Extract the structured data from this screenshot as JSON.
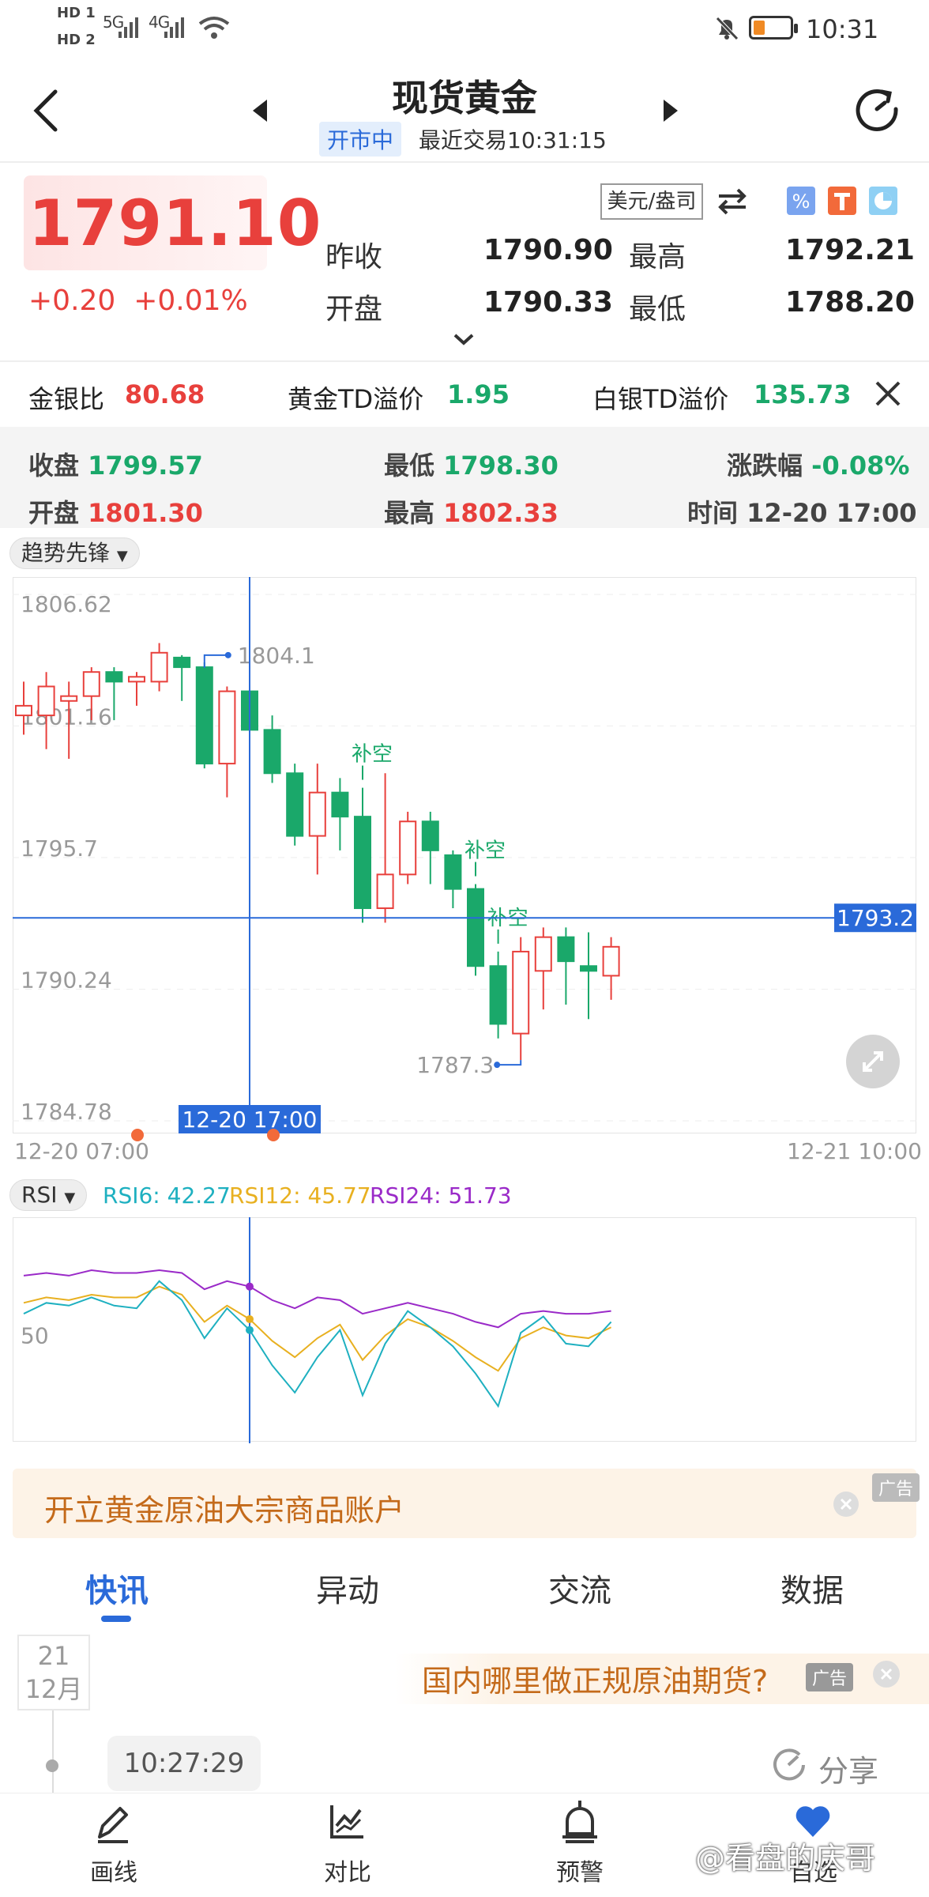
{
  "status_bar": {
    "hd1": "HD 1",
    "hd2": "HD 2",
    "net1": "5G",
    "net2": "4G",
    "time": "10:31",
    "icons": [
      "signal-icon",
      "wifi-icon",
      "mute-icon",
      "battery-icon"
    ]
  },
  "header": {
    "title": "现货黄金",
    "market_status": "开市中",
    "last_trade": "最近交易10:31:15"
  },
  "quote": {
    "price": "1791.10",
    "change": "+0.20",
    "change_pct": "+0.01%",
    "unit": "美元/盎司",
    "prev_close_label": "昨收",
    "prev_close": "1790.90",
    "high_label": "最高",
    "high": "1792.21",
    "open_label": "开盘",
    "open": "1790.33",
    "low_label": "最低",
    "low": "1788.20"
  },
  "ratios": {
    "gold_silver_label": "金银比",
    "gold_silver": "80.68",
    "gold_td_label": "黄金TD溢价",
    "gold_td": "1.95",
    "silver_td_label": "白银TD溢价",
    "silver_td": "135.73"
  },
  "candle_info": {
    "close_label": "收盘",
    "close": "1799.57",
    "low_label": "最低",
    "low": "1798.30",
    "change_label": "涨跌幅",
    "change": "-0.08%",
    "open_label": "开盘",
    "open": "1801.30",
    "high_label": "最高",
    "high": "1802.33",
    "time_label": "时间",
    "time": "12-20 17:00"
  },
  "indicator_selector": "趋势先锋",
  "rsi_selector": "RSI",
  "rsi_values": {
    "rsi6": "RSI6: 42.27",
    "rsi12": "RSI12: 45.77",
    "rsi24": "RSI24: 51.73"
  },
  "colors": {
    "up": "#e8403c",
    "down": "#1aa86a",
    "accent": "#2a6ad9",
    "rsi6": "#1eb0c0",
    "rsi12": "#e8b020",
    "rsi24": "#9a2ac8"
  },
  "chart_data": {
    "type": "candlestick",
    "y_ticks": [
      "1806.62",
      "1801.16",
      "1795.7",
      "1790.24",
      "1784.78"
    ],
    "ylim": [
      1784.78,
      1806.62
    ],
    "x_start_label": "12-20 07:00",
    "x_end_label": "12-21 10:00",
    "crosshair_x_label": "12-20 17:00",
    "crosshair_y_label": "1793.2",
    "crosshair_y": 1793.2,
    "crosshair_index": 10,
    "max_label": "1804.1",
    "max_value": 1804.1,
    "max_index": 8,
    "min_label": "1787.3",
    "min_value": 1787.3,
    "min_index": 22,
    "signal_label": "补空",
    "signal_indices": [
      15,
      20,
      21
    ],
    "candles": [
      {
        "o": 1801.6,
        "c": 1802.0,
        "h": 1803.0,
        "l": 1800.8
      },
      {
        "o": 1801.6,
        "c": 1802.8,
        "h": 1803.4,
        "l": 1800.2
      },
      {
        "o": 1802.2,
        "c": 1802.4,
        "h": 1803.0,
        "l": 1799.8
      },
      {
        "o": 1802.4,
        "c": 1803.4,
        "h": 1803.6,
        "l": 1801.4
      },
      {
        "o": 1803.4,
        "c": 1803.0,
        "h": 1803.6,
        "l": 1801.4
      },
      {
        "o": 1803.0,
        "c": 1803.2,
        "h": 1803.4,
        "l": 1802.0
      },
      {
        "o": 1803.0,
        "c": 1804.2,
        "h": 1804.6,
        "l": 1802.6
      },
      {
        "o": 1804.0,
        "c": 1803.6,
        "h": 1804.1,
        "l": 1802.2
      },
      {
        "o": 1803.6,
        "c": 1799.6,
        "h": 1803.8,
        "l": 1799.4
      },
      {
        "o": 1799.6,
        "c": 1802.6,
        "h": 1802.8,
        "l": 1798.2
      },
      {
        "o": 1802.6,
        "c": 1801.0,
        "h": 1802.8,
        "l": 1800.6
      },
      {
        "o": 1801.0,
        "c": 1799.2,
        "h": 1801.6,
        "l": 1798.8
      },
      {
        "o": 1799.2,
        "c": 1796.6,
        "h": 1799.6,
        "l": 1796.2
      },
      {
        "o": 1796.6,
        "c": 1798.4,
        "h": 1799.6,
        "l": 1795.0
      },
      {
        "o": 1798.4,
        "c": 1797.4,
        "h": 1799.0,
        "l": 1796.0
      },
      {
        "o": 1797.4,
        "c": 1793.6,
        "h": 1798.6,
        "l": 1793.0
      },
      {
        "o": 1793.6,
        "c": 1795.0,
        "h": 1799.2,
        "l": 1793.0
      },
      {
        "o": 1795.0,
        "c": 1797.2,
        "h": 1797.6,
        "l": 1794.6
      },
      {
        "o": 1797.2,
        "c": 1796.0,
        "h": 1797.6,
        "l": 1794.6
      },
      {
        "o": 1795.8,
        "c": 1794.4,
        "h": 1796.0,
        "l": 1793.6
      },
      {
        "o": 1794.4,
        "c": 1791.2,
        "h": 1794.6,
        "l": 1790.8
      },
      {
        "o": 1791.2,
        "c": 1788.8,
        "h": 1791.8,
        "l": 1788.2
      },
      {
        "o": 1788.4,
        "c": 1791.8,
        "h": 1792.4,
        "l": 1787.3
      },
      {
        "o": 1791.0,
        "c": 1792.4,
        "h": 1792.8,
        "l": 1789.4
      },
      {
        "o": 1792.4,
        "c": 1791.4,
        "h": 1792.8,
        "l": 1789.6
      },
      {
        "o": 1791.2,
        "c": 1791.0,
        "h": 1792.6,
        "l": 1789.0
      },
      {
        "o": 1790.8,
        "c": 1792.0,
        "h": 1792.4,
        "l": 1789.8
      }
    ],
    "rsi_ytick": "50",
    "rsi": {
      "rsi6": [
        58,
        62,
        61,
        64,
        61,
        60,
        70,
        63,
        49,
        60,
        52,
        39,
        29,
        42,
        52,
        28,
        47,
        59,
        53,
        46,
        36,
        24,
        51,
        57,
        47,
        46,
        55
      ],
      "rsi12": [
        62,
        64,
        63,
        65,
        64,
        64,
        68,
        65,
        55,
        61,
        56,
        48,
        42,
        49,
        54,
        41,
        50,
        56,
        53,
        48,
        42,
        37,
        49,
        53,
        50,
        49,
        53
      ],
      "rsi24": [
        72,
        73,
        72,
        74,
        73,
        73,
        74,
        73,
        67,
        70,
        68,
        63,
        60,
        64,
        63,
        58,
        60,
        62,
        60,
        58,
        55,
        53,
        58,
        59,
        58,
        58,
        59
      ]
    }
  },
  "ad_banner": {
    "text": "开立黄金原油大宗商品账户",
    "tag": "广告"
  },
  "tabs": [
    "快讯",
    "异动",
    "交流",
    "数据"
  ],
  "news": {
    "day": "21",
    "month": "12月",
    "ad_text": "国内哪里做正规原油期货?",
    "ad_tag": "广告",
    "time": "10:27:29",
    "share": "分享"
  },
  "bottom_nav": [
    "画线",
    "对比",
    "预警",
    "自选"
  ],
  "watermark": "@看盘的庆哥"
}
